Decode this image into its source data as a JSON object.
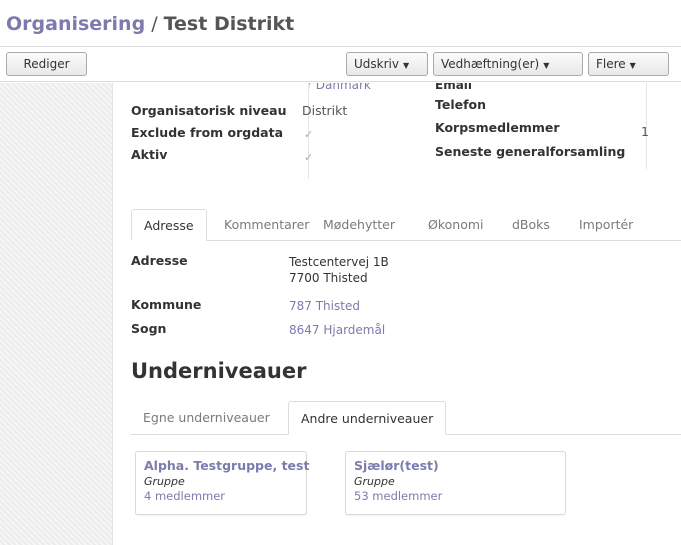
{
  "breadcrumb": {
    "parent": "Organisering",
    "separator": "/",
    "current": "Test Distrikt"
  },
  "toolbar": {
    "edit_label": "Rediger",
    "print_label": "Udskriv",
    "attachments_label": "Vedhæftning(er)",
    "more_label": "Flere"
  },
  "info": {
    "cutoff_value": "r Danmark",
    "cutoff_label": "Email",
    "level_label": "Organisatorisk niveau",
    "level_value": "Distrikt",
    "exclude_label": "Exclude from orgdata",
    "active_label": "Aktiv",
    "phone_label": "Telefon",
    "members_label": "Korpsmedlemmer",
    "members_value": "1",
    "assembly_label": "Seneste generalforsamling",
    "check_glyph": "✓"
  },
  "tabs": [
    "Adresse",
    "Kommentarer",
    "Mødehytter",
    "Økonomi",
    "dBoks",
    "Importér"
  ],
  "address": {
    "address_label": "Adresse",
    "address_line1": "Testcentervej 1B",
    "address_line2": "7700 Thisted",
    "municipality_label": "Kommune",
    "municipality_value": "787 Thisted",
    "parish_label": "Sogn",
    "parish_value": "8647 Hjardemål"
  },
  "sublevels": {
    "heading": "Underniveauer",
    "tabs": [
      "Egne underniveauer",
      "Andre underniveauer"
    ],
    "cards": [
      {
        "title": "Alpha. Testgruppe, test",
        "type": "Gruppe",
        "members": "4 medlemmer"
      },
      {
        "title": "Sjælør(test)",
        "type": "Gruppe",
        "members": "53 medlemmer"
      }
    ]
  },
  "colors": {
    "accent": "#7c7bad",
    "text": "#333333",
    "muted": "#7a7a7a"
  },
  "icons": {
    "dropdown": "caret-down-icon",
    "checkbox": "checkmark-icon"
  }
}
